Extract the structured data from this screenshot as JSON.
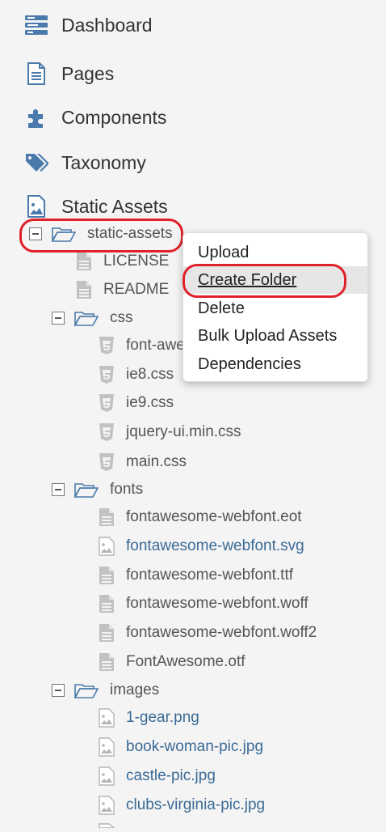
{
  "nav": [
    {
      "label": "Dashboard",
      "icon": "dashboard-icon"
    },
    {
      "label": "Pages",
      "icon": "page-icon"
    },
    {
      "label": "Components",
      "icon": "puzzle-icon"
    },
    {
      "label": "Taxonomy",
      "icon": "tags-icon"
    },
    {
      "label": "Static Assets",
      "icon": "image-icon"
    }
  ],
  "tree": {
    "root": {
      "name": "static-assets"
    },
    "root_files": [
      "LICENSE",
      "README"
    ],
    "css": {
      "name": "css",
      "files": [
        "font-awesome.min.css",
        "ie8.css",
        "ie9.css",
        "jquery-ui.min.css",
        "main.css"
      ]
    },
    "fonts": {
      "name": "fonts",
      "files": [
        "fontawesome-webfont.eot",
        "fontawesome-webfont.svg",
        "fontawesome-webfont.ttf",
        "fontawesome-webfont.woff",
        "fontawesome-webfont.woff2",
        "FontAwesome.otf"
      ]
    },
    "images": {
      "name": "images",
      "files": [
        "1-gear.png",
        "book-woman-pic.jpg",
        "castle-pic.jpg",
        "clubs-virginia-pic.jpg"
      ]
    }
  },
  "context_menu": {
    "items": [
      "Upload",
      "Create Folder",
      "Delete",
      "Bulk Upload Assets",
      "Dependencies"
    ],
    "highlighted": "Create Folder"
  },
  "colors": {
    "link": "#3a6a96",
    "highlight_ring": "#e0202a",
    "icon_blue": "#4a7aab"
  }
}
